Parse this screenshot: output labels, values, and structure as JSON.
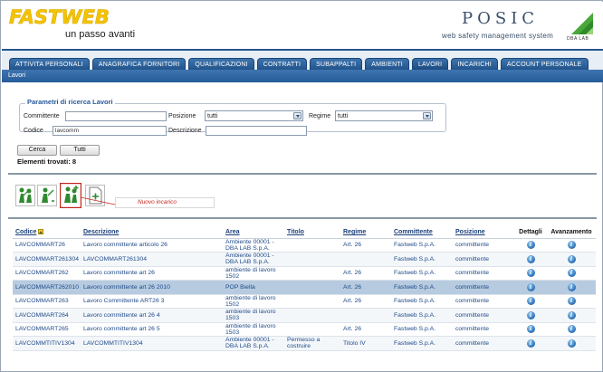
{
  "header": {
    "brand": "FASTWEB",
    "tagline": "un passo avanti",
    "product": "POSIC",
    "product_sub": "web safety management system",
    "partner": "DBA LAB"
  },
  "tabs": [
    {
      "label": "ATTIVITA PERSONALI"
    },
    {
      "label": "ANAGRAFICA FORNITORI"
    },
    {
      "label": "QUALIFICAZIONI"
    },
    {
      "label": "CONTRATTI"
    },
    {
      "label": "SUBAPPALTI"
    },
    {
      "label": "AMBIENTI"
    },
    {
      "label": "LAVORI",
      "active": true
    },
    {
      "label": "INCARICHI"
    },
    {
      "label": "ACCOUNT PERSONALE"
    }
  ],
  "section": {
    "title": "Lavori"
  },
  "search": {
    "legend": "Parametri di ricerca Lavori",
    "committente_label": "Committente",
    "committente_value": "",
    "posizione_label": "Posizione",
    "posizione_value": "tutti",
    "regime_label": "Regime",
    "regime_value": "tutti",
    "codice_label": "Codice",
    "codice_value": "lavcomm",
    "descrizione_label": "Descrizione",
    "descrizione_value": "",
    "cerca_label": "Cerca",
    "tutti_label": "Tutti",
    "found_text": "Elementi trovati: 8"
  },
  "toolbar": {
    "tooltip": "Nuovo incarico"
  },
  "table": {
    "headers": {
      "codice": "Codice",
      "descrizione": "Descrizione",
      "area": "Area",
      "titolo": "Titolo",
      "regime": "Regime",
      "committente": "Committente",
      "posizione": "Posizione",
      "dettagli": "Dettagli",
      "avanzamento": "Avanzamento"
    },
    "rows": [
      {
        "codice": "LAVCOMMART26",
        "descrizione": "Lavoro committente articolo 26",
        "area": "Ambiente 00001 - DBA LAB S.p.A.",
        "titolo": "",
        "regime": "Art. 26",
        "committente": "Fastweb S.p.A.",
        "posizione": "committente",
        "icon_d": "i",
        "icon_a": "i"
      },
      {
        "codice": "LAVCOMMART261304",
        "descrizione": "LAVCOMMART261304",
        "area": "Ambiente 00001 - DBA LAB S.p.A.",
        "titolo": "",
        "regime": "",
        "committente": "Fastweb S.p.A.",
        "posizione": "committente",
        "icon_d": "i",
        "icon_a": "i"
      },
      {
        "codice": "LAVCOMMART262",
        "descrizione": "Lavoro committente art 26",
        "area": "ambiente di lavoro 1502",
        "titolo": "",
        "regime": "Art. 26",
        "committente": "Fastweb S.p.A.",
        "posizione": "committente",
        "icon_d": "i",
        "icon_a": "i"
      },
      {
        "codice": "LAVCOMMART262010",
        "descrizione": "Lavoro committente art 26 2010",
        "area": "POP Biella",
        "titolo": "",
        "regime": "Art. 26",
        "committente": "Fastweb S.p.A.",
        "posizione": "committente",
        "icon_d": "i",
        "icon_a": "i",
        "highlight": true
      },
      {
        "codice": "LAVCOMMART263",
        "descrizione": "Lavoro Committente ART26 3",
        "area": "ambiente di lavoro 1502",
        "titolo": "",
        "regime": "Art. 26",
        "committente": "Fastweb S.p.A.",
        "posizione": "committente",
        "icon_d": "i",
        "icon_a": "i"
      },
      {
        "codice": "LAVCOMMART264",
        "descrizione": "Lavoro committente art 26 4",
        "area": "ambiente di lavoro 1503",
        "titolo": "",
        "regime": "",
        "committente": "Fastweb S.p.A.",
        "posizione": "committente",
        "icon_d": "i",
        "icon_a": "i"
      },
      {
        "codice": "LAVCOMMART265",
        "descrizione": "Lavoro committente art 26 5",
        "area": "ambiente di lavoro 1503",
        "titolo": "",
        "regime": "Art. 26",
        "committente": "Fastweb S.p.A.",
        "posizione": "committente",
        "icon_d": "i",
        "icon_a": "i"
      },
      {
        "codice": "LAVCOMMTITIV1304",
        "descrizione": "LAVCOMMTITIV1304",
        "area": "Ambiente 00001 - DBA LAB S.p.A.",
        "titolo": "Permesso a costruire",
        "regime": "Titolo IV",
        "committente": "Fastweb S.p.A.",
        "posizione": "committente",
        "icon_d": "i",
        "icon_a": "i"
      }
    ]
  }
}
